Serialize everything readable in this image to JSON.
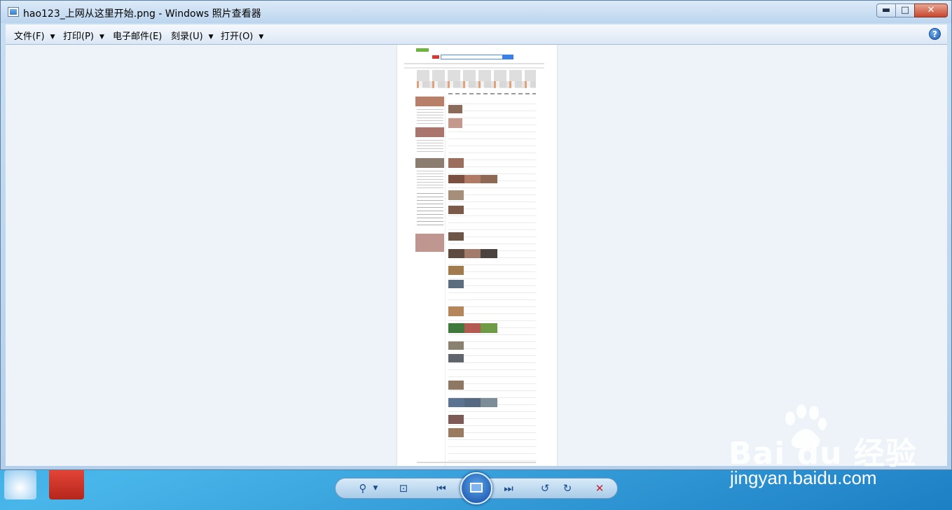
{
  "window": {
    "title": "hao123_上网从这里开始.png - Windows 照片查看器",
    "min_label": "▬",
    "max_label": "□",
    "close_label": "✕"
  },
  "menu": {
    "items": [
      {
        "label": "文件(F)"
      },
      {
        "label": "打印(P)"
      },
      {
        "label": "电子邮件(E)"
      },
      {
        "label": "刻录(U)"
      },
      {
        "label": "打开(O)"
      }
    ],
    "help": "?"
  },
  "toolbar": {
    "icons": [
      "zoom-icon",
      "actual-size-icon",
      "previous-icon",
      "slideshow-icon",
      "next-icon",
      "rotate-left-icon",
      "rotate-right-icon",
      "delete-icon"
    ]
  },
  "watermark": {
    "logo": "Bai du 经验",
    "url": "jingyan.baidu.com"
  },
  "colors": {
    "accent": "#1d4e8c",
    "delete": "#c7202a",
    "close": "#c7472e"
  }
}
